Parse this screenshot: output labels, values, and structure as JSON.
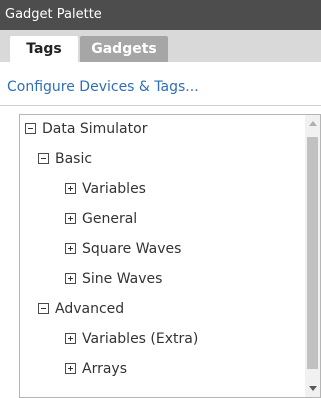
{
  "panel": {
    "title": "Gadget Palette"
  },
  "tabs": [
    {
      "label": "Tags",
      "active": true
    },
    {
      "label": "Gadgets",
      "active": false
    }
  ],
  "configure_link": "Configure Devices & Tags...",
  "tree": {
    "items": [
      {
        "label": "Data Simulator",
        "state": "expanded",
        "level": 0
      },
      {
        "label": "Basic",
        "state": "expanded",
        "level": 1
      },
      {
        "label": "Variables",
        "state": "collapsed",
        "level": 2
      },
      {
        "label": "General",
        "state": "collapsed",
        "level": 2
      },
      {
        "label": "Square Waves",
        "state": "collapsed",
        "level": 2
      },
      {
        "label": "Sine Waves",
        "state": "collapsed",
        "level": 2
      },
      {
        "label": "Advanced",
        "state": "expanded",
        "level": 1
      },
      {
        "label": "Variables (Extra)",
        "state": "collapsed",
        "level": 2
      },
      {
        "label": "Arrays",
        "state": "collapsed",
        "level": 2
      }
    ]
  },
  "colors": {
    "titlebar": "#4d4d4d",
    "tabstrip": "#d9d9d9",
    "inactive_tab": "#a6a6a6",
    "link": "#2f6fb3"
  }
}
